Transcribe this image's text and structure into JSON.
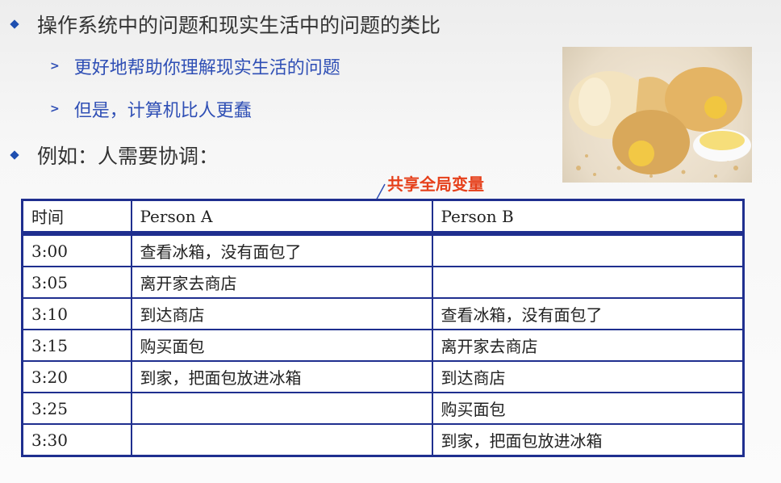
{
  "bullets": {
    "main1": "操作系统中的问题和现实生活中的问题的类比",
    "sub1": "更好地帮助你理解现实生活的问题",
    "sub2": "但是，计算机比人更蠢",
    "main2": "例如：人需要协调："
  },
  "annotation": {
    "label": "共享全局变量",
    "color": "#e6401b"
  },
  "image": {
    "subject": "bread-rolls-with-butter-photo"
  },
  "table": {
    "headers": [
      "时间",
      "Person A",
      "Person B"
    ],
    "rows": [
      [
        "3:00",
        "查看冰箱，没有面包了",
        ""
      ],
      [
        "3:05",
        "离开家去商店",
        ""
      ],
      [
        "3:10",
        "到达商店",
        "查看冰箱，没有面包了"
      ],
      [
        "3:15",
        "购买面包",
        "离开家去商店"
      ],
      [
        "3:20",
        "到家，把面包放进冰箱",
        "到达商店"
      ],
      [
        "3:25",
        "",
        "购买面包"
      ],
      [
        "3:30",
        "",
        "到家，把面包放进冰箱"
      ]
    ]
  },
  "colors": {
    "bullet": "#1e4fb0",
    "subtext": "#2f4fb5",
    "table_border": "#1f2f8f"
  }
}
